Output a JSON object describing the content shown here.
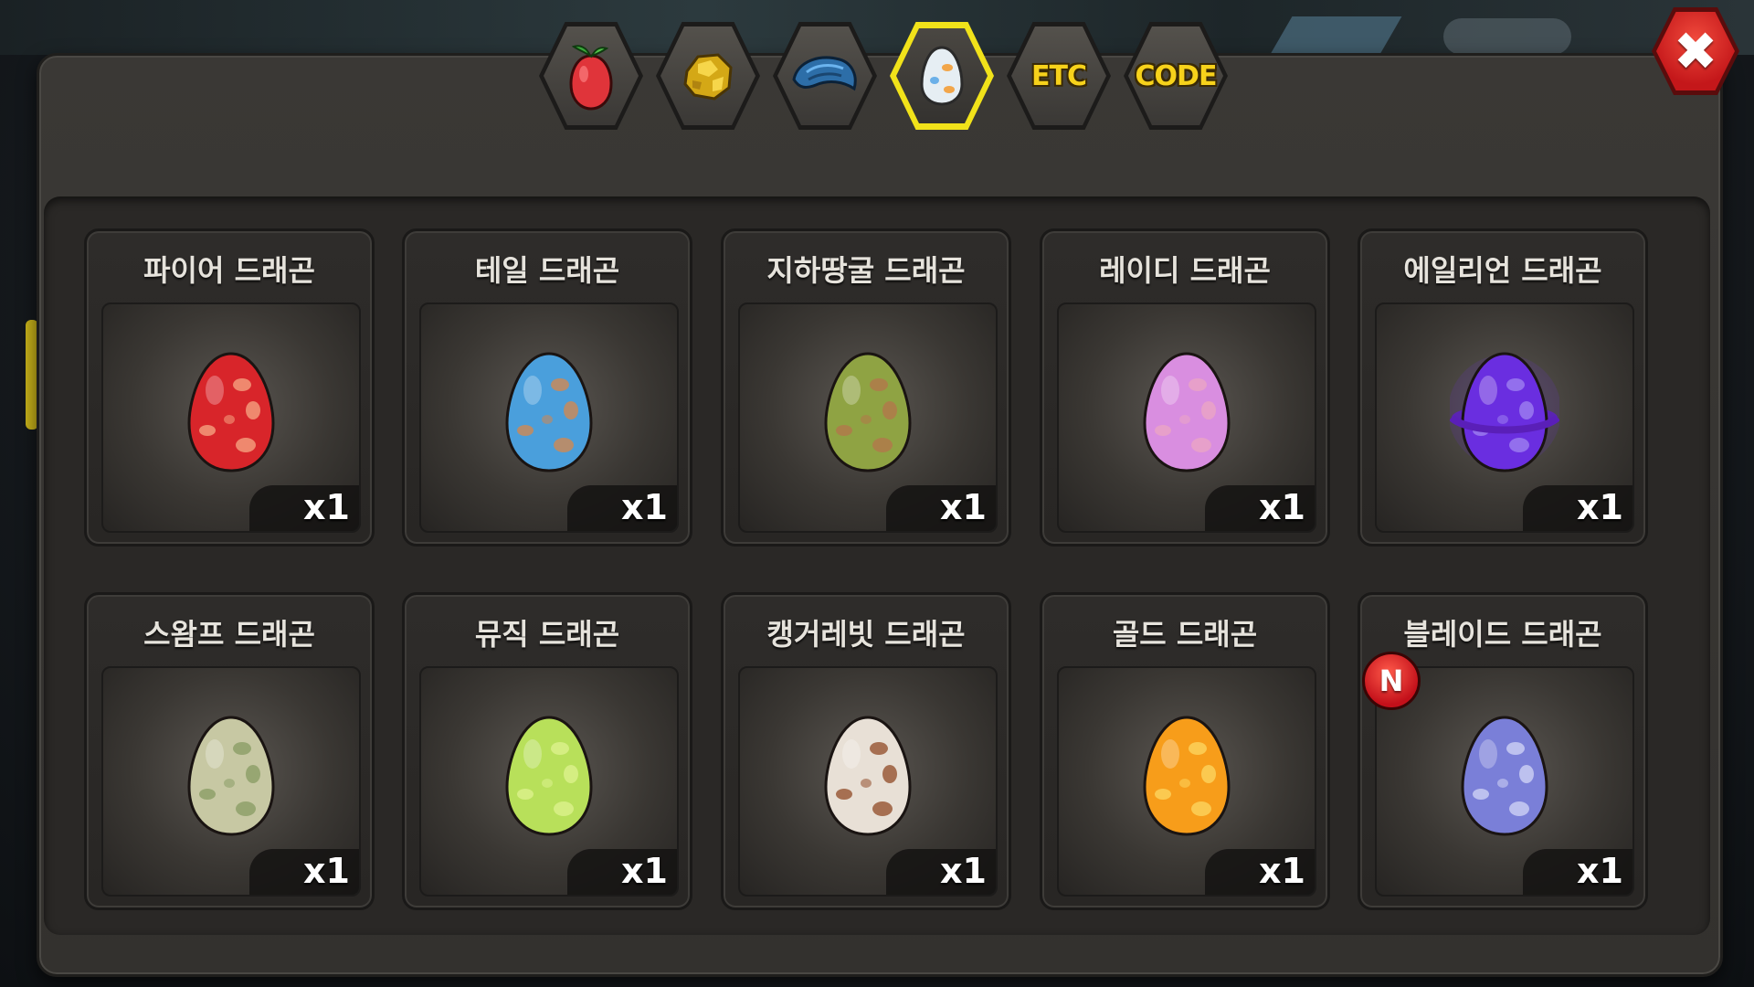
{
  "header": {
    "tabs": [
      {
        "name": "fruit",
        "icon": "fruit-icon",
        "label": "",
        "active": false
      },
      {
        "name": "gold",
        "icon": "gold-ore-icon",
        "label": "",
        "active": false
      },
      {
        "name": "scale",
        "icon": "blue-scale-icon",
        "label": "",
        "active": false
      },
      {
        "name": "egg",
        "icon": "egg-icon",
        "label": "",
        "active": true
      },
      {
        "name": "etc",
        "icon": "",
        "label": "ETC",
        "active": false
      },
      {
        "name": "code",
        "icon": "",
        "label": "CODE",
        "active": false
      }
    ],
    "close_icon": "close-icon"
  },
  "items": [
    {
      "name": "파이어 드래곤",
      "qty": "x1",
      "color": "#d8252a",
      "spot": "#f39a7a",
      "new": false
    },
    {
      "name": "테일 드래곤",
      "qty": "x1",
      "color": "#4a9fdc",
      "spot": "#c8895a",
      "new": false
    },
    {
      "name": "지하땅굴 드래곤",
      "qty": "x1",
      "color": "#8fa343",
      "spot": "#b07a4a",
      "new": false
    },
    {
      "name": "레이디 드래곤",
      "qty": "x1",
      "color": "#d98ee0",
      "spot": "#e9a3c6",
      "new": false
    },
    {
      "name": "에일리언 드래곤",
      "qty": "x1",
      "color": "#6a2ee0",
      "spot": "#9a7aef",
      "new": false,
      "ring": true
    },
    {
      "name": "스왐프 드래곤",
      "qty": "x1",
      "color": "#c7c8a3",
      "spot": "#8ea06a",
      "new": false
    },
    {
      "name": "뮤직 드래곤",
      "qty": "x1",
      "color": "#b8e05a",
      "spot": "#d9f08a",
      "new": false
    },
    {
      "name": "캥거레빗 드래곤",
      "qty": "x1",
      "color": "#e8e0d6",
      "spot": "#9a5a3a",
      "new": false
    },
    {
      "name": "골드 드래곤",
      "qty": "x1",
      "color": "#f79d1a",
      "spot": "#fbd15a",
      "new": false
    },
    {
      "name": "블레이드 드래곤",
      "qty": "x1",
      "color": "#7a7fd8",
      "spot": "#c9cdf3",
      "new": true,
      "new_label": "N"
    }
  ]
}
